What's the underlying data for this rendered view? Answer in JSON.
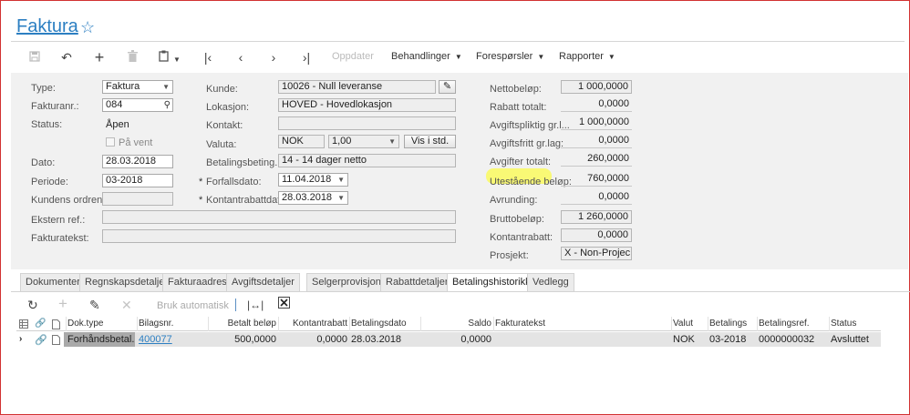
{
  "page": {
    "title": "Faktura",
    "favorite_icon": "star-outline-icon"
  },
  "toolbar": {
    "icons": [
      "save-icon",
      "undo-icon",
      "add-icon",
      "delete-icon",
      "copy-paste-icon",
      "first-icon",
      "previous-icon",
      "next-icon",
      "last-icon"
    ],
    "update_label": "Oppdater",
    "actions_label": "Behandlinger",
    "inquiries_label": "Forespørsler",
    "reports_label": "Rapporter"
  },
  "form": {
    "type": {
      "label": "Type:",
      "value": "Faktura"
    },
    "invoice_no": {
      "label": "Fakturanr.:",
      "value": "084"
    },
    "status": {
      "label": "Status:",
      "value": "Åpen"
    },
    "on_hold": {
      "label": "På vent",
      "checked": false
    },
    "date": {
      "label": "Dato:",
      "value": "28.03.2018"
    },
    "period": {
      "label": "Periode:",
      "value": "03-2018"
    },
    "customer_order": {
      "label": "Kundens ordrenr.:",
      "value": ""
    },
    "external_ref": {
      "label": "Ekstern ref.:",
      "value": ""
    },
    "invoice_text": {
      "label": "Fakturatekst:",
      "value": ""
    },
    "customer": {
      "label": "Kunde:",
      "value": "10026 - Null leveranse"
    },
    "location": {
      "label": "Lokasjon:",
      "value": "HOVED - Hovedlokasjon"
    },
    "contact": {
      "label": "Kontakt:",
      "value": ""
    },
    "currency": {
      "label": "Valuta:",
      "value": "NOK",
      "rate": "1,00",
      "view_btn": "Vis i std."
    },
    "payment_terms": {
      "label": "Betalingsbeting...",
      "value": "14 - 14 dager netto"
    },
    "due_date": {
      "star": "*",
      "label": "Forfallsdato:",
      "value": "11.04.2018"
    },
    "discount_date": {
      "star": "*",
      "label": "Kontantrabattdato:",
      "value": "28.03.2018"
    }
  },
  "totals": [
    {
      "label": "Nettobeløp:",
      "value": "1 000,0000",
      "boxed": true
    },
    {
      "label": "Rabatt totalt:",
      "value": "0,0000",
      "boxed": false
    },
    {
      "label": "Avgiftspliktig gr.l...",
      "value": "1 000,0000",
      "boxed": false
    },
    {
      "label": "Avgiftsfritt gr.lag:",
      "value": "0,0000",
      "boxed": false
    },
    {
      "label": "Avgifter totalt:",
      "value": "260,0000",
      "boxed": false
    },
    {
      "label": "Utestående beløp:",
      "value": "760,0000",
      "boxed": false
    },
    {
      "label": "Avrunding:",
      "value": "0,0000",
      "boxed": false
    },
    {
      "label": "Bruttobeløp:",
      "value": "1 260,0000",
      "boxed": true
    },
    {
      "label": "Kontantrabatt:",
      "value": "0,0000",
      "boxed": true
    },
    {
      "label": "Prosjekt:",
      "value": "X - Non-Projec",
      "boxed": true
    }
  ],
  "tabs": [
    "Dokumenter",
    "Regnskapsdetaljer",
    "Fakturaadresse",
    "Avgiftsdetaljer",
    "Selgerprovisjon",
    "Rabattdetaljer",
    "Betalingshistorikk",
    "Vedlegg"
  ],
  "active_tab": "Betalingshistorikk",
  "grid_toolbar": {
    "icons": [
      "refresh-icon",
      "add-icon",
      "edit-icon",
      "delete-icon",
      "fit-columns-icon",
      "excel-export-icon"
    ],
    "apply_auto": "Bruk automatisk"
  },
  "grid": {
    "columns": [
      "Dok.type",
      "Bilagsnr.",
      "Betalt beløp",
      "Kontantrabatt",
      "Betalingsdato",
      "Saldo",
      "Fakturatekst",
      "Valut",
      "Betalings",
      "Betalingsref.",
      "Status"
    ],
    "rows": [
      [
        "Forhåndsbetal...",
        "400077",
        "500,0000",
        "0,0000",
        "28.03.2018",
        "0,0000",
        "",
        "NOK",
        "03-2018",
        "0000000032",
        "Avsluttet"
      ]
    ]
  },
  "accent_color": "#2c7fc2",
  "highlight_color": "#fbfb56"
}
